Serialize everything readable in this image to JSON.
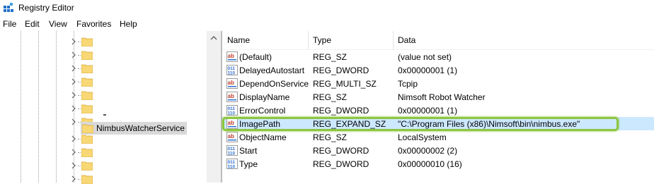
{
  "window": {
    "title": "Registry Editor"
  },
  "menu": [
    "File",
    "Edit",
    "View",
    "Favorites",
    "Help"
  ],
  "tree": {
    "selected_key": "NimbusWatcherService"
  },
  "columns": {
    "name": "Name",
    "type": "Type",
    "data": "Data"
  },
  "values": [
    {
      "icon": "string-value-icon",
      "name": "(Default)",
      "type": "REG_SZ",
      "data": "(value not set)"
    },
    {
      "icon": "binary-value-icon",
      "name": "DelayedAutostart",
      "type": "REG_DWORD",
      "data": "0x00000001 (1)"
    },
    {
      "icon": "string-value-icon",
      "name": "DependOnService",
      "type": "REG_MULTI_SZ",
      "data": "Tcpip"
    },
    {
      "icon": "string-value-icon",
      "name": "DisplayName",
      "type": "REG_SZ",
      "data": "Nimsoft Robot Watcher"
    },
    {
      "icon": "binary-value-icon",
      "name": "ErrorControl",
      "type": "REG_DWORD",
      "data": "0x00000001 (1)"
    },
    {
      "icon": "string-value-icon",
      "name": "ImagePath",
      "type": "REG_EXPAND_SZ",
      "data": "\"C:\\Program Files (x86)\\Nimsoft\\bin\\nimbus.exe\"",
      "selected": true
    },
    {
      "icon": "string-value-icon",
      "name": "ObjectName",
      "type": "REG_SZ",
      "data": "LocalSystem"
    },
    {
      "icon": "binary-value-icon",
      "name": "Start",
      "type": "REG_DWORD",
      "data": "0x00000002 (2)"
    },
    {
      "icon": "binary-value-icon",
      "name": "Type",
      "type": "REG_DWORD",
      "data": "0x00000010 (16)"
    }
  ],
  "colors": {
    "selection": "#cce8ff",
    "highlight": "#8dc63f",
    "folder": "#f8d775"
  }
}
